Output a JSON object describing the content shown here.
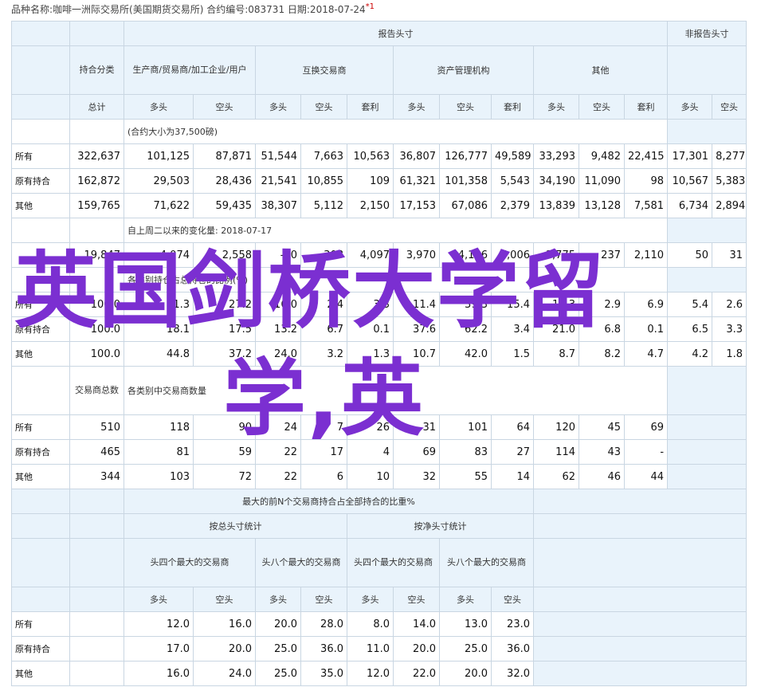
{
  "header": {
    "info": "品种名称:咖啡一洲际交易所(美国期货交易所)  合约编号:083731  日期:2018-07-24",
    "mark": "*1"
  },
  "headers": {
    "report": "报告头寸",
    "nonreport": "非报告头寸",
    "category": "持合分类",
    "prod": "生产商/贸易商/加工企业/用户",
    "swap": "互换交易商",
    "asset": "资产管理机构",
    "other": "其他",
    "total": "总计",
    "long": "多头",
    "short": "空头",
    "spread": "套利"
  },
  "sections": {
    "contract_unit": "(合约大小为37,500磅)",
    "change_since": "自上周二以来的变化量: 2018-07-17",
    "pct_heading": "各类别持仓占总持仓的比例(%)",
    "dealers_label": "交易商总数",
    "dealers_heading": "各类别中交易商数量",
    "topn_title": "最大的前N个交易商持合占全部持合的比重%",
    "gross": "按总头寸统计",
    "net": "按净头寸统计",
    "top4": "头四个最大的交易商",
    "top8": "头八个最大的交易商"
  },
  "row_labels": {
    "all": "所有",
    "old": "原有持合",
    "other": "其他"
  },
  "positions": [
    [
      "322,637",
      "101,125",
      "87,871",
      "51,544",
      "7,663",
      "10,563",
      "36,807",
      "126,777",
      "49,589",
      "33,293",
      "9,482",
      "22,415",
      "17,301",
      "8,277"
    ],
    [
      "162,872",
      "29,503",
      "28,436",
      "21,541",
      "10,855",
      "109",
      "61,321",
      "101,358",
      "5,543",
      "34,190",
      "11,090",
      "98",
      "10,567",
      "5,383"
    ],
    [
      "159,765",
      "71,622",
      "59,435",
      "38,307",
      "5,112",
      "2,150",
      "17,153",
      "67,086",
      "2,379",
      "13,839",
      "13,128",
      "7,581",
      "6,734",
      "2,894"
    ]
  ],
  "changes": [
    "19,847",
    "4,074",
    "2,558",
    "-60",
    "-308",
    "4,097",
    "3,970",
    "4,116",
    "7,006",
    "-1,775",
    "237",
    "2,110",
    "50",
    "31"
  ],
  "percents": [
    [
      "100.0",
      "31.3",
      "27.2",
      "16.0",
      "2.4",
      "3.3",
      "11.4",
      "39.3",
      "15.4",
      "10.3",
      "2.9",
      "6.9",
      "5.4",
      "2.6"
    ],
    [
      "100.0",
      "18.1",
      "17.5",
      "13.2",
      "6.7",
      "0.1",
      "37.6",
      "62.2",
      "3.4",
      "21.0",
      "6.8",
      "0.1",
      "6.5",
      "3.3"
    ],
    [
      "100.0",
      "44.8",
      "37.2",
      "24.0",
      "3.2",
      "1.3",
      "10.7",
      "42.0",
      "1.5",
      "8.7",
      "8.2",
      "4.7",
      "4.2",
      "1.8"
    ]
  ],
  "dealers": [
    [
      "510",
      "118",
      "90",
      "24",
      "7",
      "26",
      "31",
      "101",
      "64",
      "120",
      "45",
      "69",
      "",
      ""
    ],
    [
      "465",
      "81",
      "59",
      "22",
      "17",
      "4",
      "69",
      "83",
      "27",
      "114",
      "43",
      "-",
      "",
      ""
    ],
    [
      "344",
      "103",
      "72",
      "22",
      "6",
      "10",
      "32",
      "55",
      "14",
      "62",
      "46",
      "44",
      "",
      ""
    ]
  ],
  "topn": [
    [
      "12.0",
      "16.0",
      "20.0",
      "28.0",
      "8.0",
      "14.0",
      "13.0",
      "23.0"
    ],
    [
      "17.0",
      "20.0",
      "25.0",
      "36.0",
      "11.0",
      "20.0",
      "25.0",
      "36.0"
    ],
    [
      "16.0",
      "24.0",
      "25.0",
      "35.0",
      "12.0",
      "22.0",
      "20.0",
      "32.0"
    ]
  ],
  "overlay": {
    "line1": "英国剑桥大学留",
    "line2": "学,英"
  }
}
